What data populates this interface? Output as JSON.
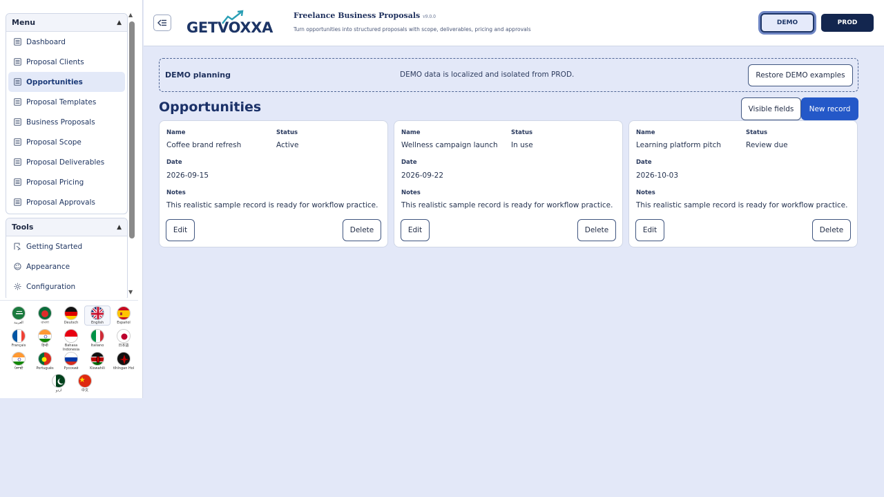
{
  "sidebar": {
    "menu_title": "Menu",
    "menu_items": [
      {
        "label": "Dashboard",
        "icon": "list-icon",
        "active": false
      },
      {
        "label": "Proposal Clients",
        "icon": "list-icon",
        "active": false
      },
      {
        "label": "Opportunities",
        "icon": "list-icon",
        "active": true
      },
      {
        "label": "Proposal Templates",
        "icon": "list-icon",
        "active": false
      },
      {
        "label": "Business Proposals",
        "icon": "list-icon",
        "active": false
      },
      {
        "label": "Proposal Scope",
        "icon": "list-icon",
        "active": false
      },
      {
        "label": "Proposal Deliverables",
        "icon": "list-icon",
        "active": false
      },
      {
        "label": "Proposal Pricing",
        "icon": "list-icon",
        "active": false
      },
      {
        "label": "Proposal Approvals",
        "icon": "list-icon",
        "active": false
      }
    ],
    "tools_title": "Tools",
    "tools_items": [
      {
        "label": "Getting Started",
        "icon": "start-icon"
      },
      {
        "label": "Appearance",
        "icon": "palette-icon"
      },
      {
        "label": "Configuration",
        "icon": "gear-icon"
      }
    ],
    "languages": [
      {
        "name": "العربية",
        "flag": "sa"
      },
      {
        "name": "বাংলা",
        "flag": "bd"
      },
      {
        "name": "Deutsch",
        "flag": "de"
      },
      {
        "name": "English",
        "flag": "gb",
        "active": true
      },
      {
        "name": "Español",
        "flag": "es"
      },
      {
        "name": "Français",
        "flag": "fr"
      },
      {
        "name": "हिन्दी",
        "flag": "in"
      },
      {
        "name": "Bahasa Indonesia",
        "flag": "id"
      },
      {
        "name": "Italiano",
        "flag": "it"
      },
      {
        "name": "日本語",
        "flag": "jp"
      },
      {
        "name": "ਪੰਜਾਬੀ",
        "flag": "in2"
      },
      {
        "name": "Português",
        "flag": "pt"
      },
      {
        "name": "Русский",
        "flag": "ru"
      },
      {
        "name": "Kiswahili",
        "flag": "ke"
      },
      {
        "name": "tlhIngan Hol",
        "flag": "kl"
      },
      {
        "name": "اردو",
        "flag": "pk"
      },
      {
        "name": "中文",
        "flag": "cn"
      }
    ]
  },
  "header": {
    "logo_text": "GETVOXXA",
    "app_title": "Freelance Business Proposals",
    "version": "v9.0.0",
    "subtitle": "Turn opportunities into structured proposals with scope, deliverables, pricing and approvals",
    "demo_label": "DEMO",
    "prod_label": "PROD"
  },
  "banner": {
    "title": "DEMO planning",
    "info": "DEMO data is localized and isolated from PROD.",
    "restore_label": "Restore DEMO examples"
  },
  "page": {
    "title": "Opportunities",
    "visible_fields_label": "Visible fields",
    "new_record_label": "New record"
  },
  "field_labels": {
    "name": "Name",
    "status": "Status",
    "date": "Date",
    "notes": "Notes",
    "edit": "Edit",
    "delete": "Delete"
  },
  "records": [
    {
      "name": "Coffee brand refresh",
      "status": "Active",
      "date": "2026-09-15",
      "notes": "This realistic sample record is ready for workflow practice."
    },
    {
      "name": "Wellness campaign launch",
      "status": "In use",
      "date": "2026-09-22",
      "notes": "This realistic sample record is ready for workflow practice."
    },
    {
      "name": "Learning platform pitch",
      "status": "Review due",
      "date": "2026-10-03",
      "notes": "This realistic sample record is ready for workflow practice."
    }
  ],
  "colors": {
    "accent": "#2458c8",
    "navy": "#13264f",
    "background": "#e3e8f8"
  }
}
